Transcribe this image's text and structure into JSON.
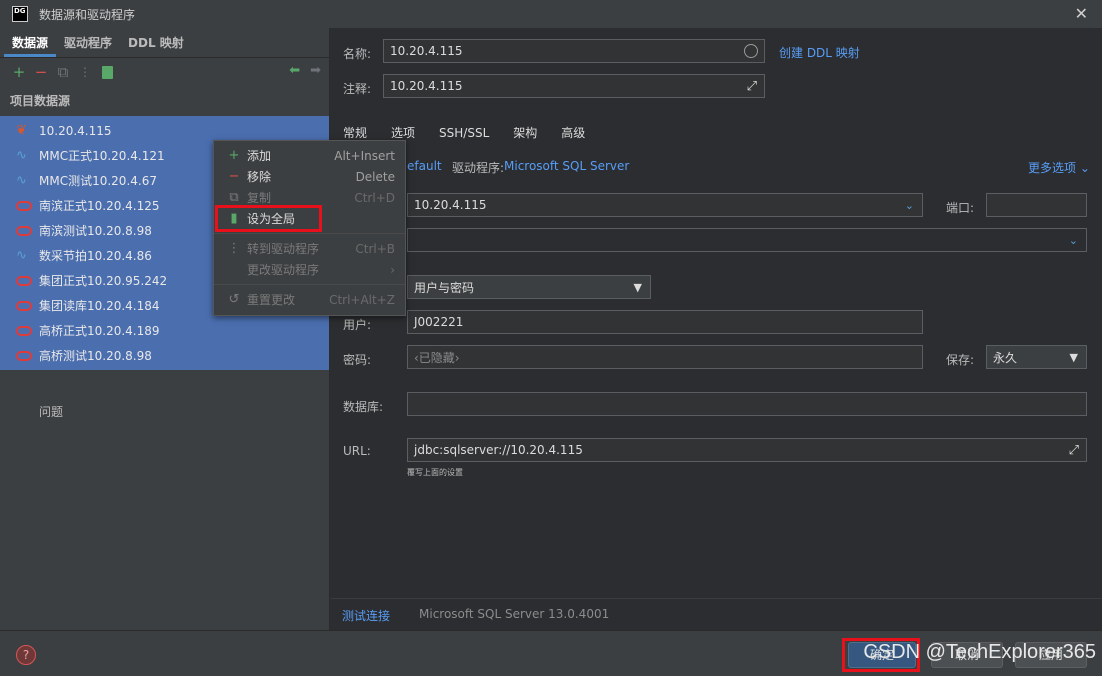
{
  "window": {
    "title": "数据源和驱动程序",
    "logo": "DG"
  },
  "left_tabs": [
    "数据源",
    "驱动程序",
    "DDL 映射"
  ],
  "section_title": "项目数据源",
  "datasources": [
    {
      "label": "10.20.4.115",
      "icon": "leaf-icon"
    },
    {
      "label": "MMC正式10.20.4.121",
      "icon": "mssql-icon"
    },
    {
      "label": "MMC测试10.20.4.67",
      "icon": "mssql-icon"
    },
    {
      "label": "南滨正式10.20.4.125",
      "icon": "oracle-icon"
    },
    {
      "label": "南滨测试10.20.8.98",
      "icon": "oracle-icon"
    },
    {
      "label": "数采节拍10.20.4.86",
      "icon": "mssql-icon"
    },
    {
      "label": "集团正式10.20.95.242",
      "icon": "oracle-icon"
    },
    {
      "label": "集团读库10.20.4.184",
      "icon": "oracle-icon"
    },
    {
      "label": "高桥正式10.20.4.189",
      "icon": "oracle-icon"
    },
    {
      "label": "高桥测试10.20.8.98",
      "icon": "oracle-icon"
    }
  ],
  "problems_label": "问题",
  "context_menu": {
    "items": [
      {
        "label": "添加",
        "shortcut": "Alt+Insert",
        "icon": "plus-icon"
      },
      {
        "label": "移除",
        "shortcut": "Delete",
        "icon": "minus-icon"
      },
      {
        "label": "复制",
        "shortcut": "Ctrl+D",
        "icon": "copy-icon"
      },
      {
        "label": "设为全局",
        "shortcut": "",
        "icon": "global-file-icon"
      },
      {
        "label": "转到驱动程序",
        "shortcut": "Ctrl+B",
        "icon": "driver-icon"
      },
      {
        "label": "更改驱动程序",
        "shortcut": "›",
        "icon": ""
      },
      {
        "label": "重置更改",
        "shortcut": "Ctrl+Alt+Z",
        "icon": "reset-icon"
      }
    ]
  },
  "form": {
    "name_label": "名称:",
    "name_value": "10.20.4.115",
    "create_ddl_link": "创建 DDL 映射",
    "comment_label": "注释:",
    "comment_value": "10.20.4.115",
    "tabs": [
      "常规",
      "选项",
      "SSH/SSL",
      "架构",
      "高级"
    ],
    "connection_type_partial": "efault",
    "driver_label": "驱动程序:",
    "driver_value": "Microsoft SQL Server",
    "more_options": "更多选项 ⌄",
    "host_value": "10.20.4.115",
    "port_label": "端口:",
    "port_value": "",
    "auth_value": "用户与密码",
    "user_label": "用户:",
    "user_value": "J002221",
    "password_label": "密码:",
    "password_value": "‹已隐藏›",
    "save_label": "保存:",
    "save_value": "永久",
    "database_label": "数据库:",
    "database_value": "",
    "url_label": "URL:",
    "url_value": "jdbc:sqlserver://10.20.4.115",
    "url_hint": "覆写上面的设置"
  },
  "status": {
    "test_connection": "测试连接",
    "server_version": "Microsoft SQL Server 13.0.4001"
  },
  "bottom": {
    "ok_label": "确定",
    "cancel_label": "取消",
    "apply_label": "应用",
    "watermark": "CSDN @TechExplorer365"
  }
}
